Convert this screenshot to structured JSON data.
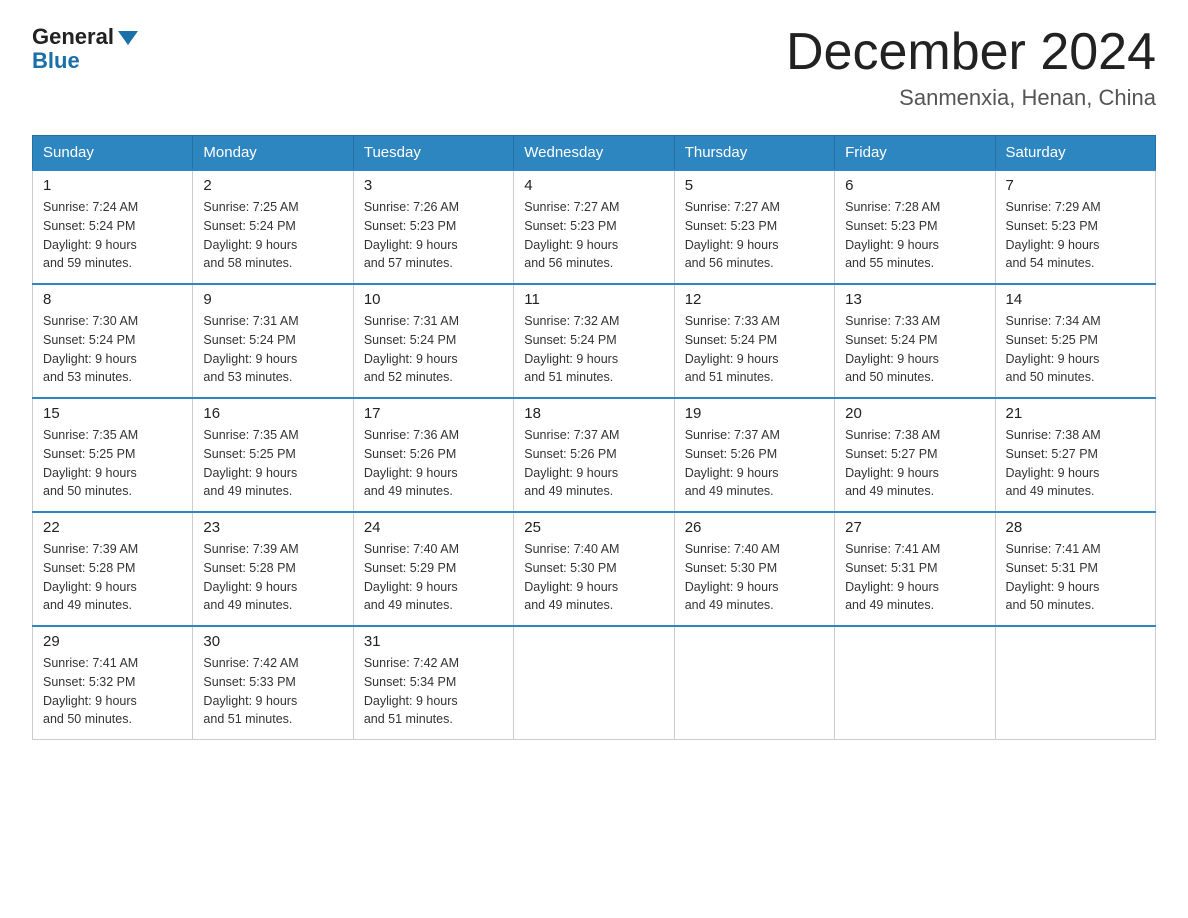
{
  "logo": {
    "general": "General",
    "blue": "Blue"
  },
  "title": "December 2024",
  "location": "Sanmenxia, Henan, China",
  "days_of_week": [
    "Sunday",
    "Monday",
    "Tuesday",
    "Wednesday",
    "Thursday",
    "Friday",
    "Saturday"
  ],
  "weeks": [
    [
      {
        "day": "1",
        "sunrise": "7:24 AM",
        "sunset": "5:24 PM",
        "daylight": "9 hours and 59 minutes."
      },
      {
        "day": "2",
        "sunrise": "7:25 AM",
        "sunset": "5:24 PM",
        "daylight": "9 hours and 58 minutes."
      },
      {
        "day": "3",
        "sunrise": "7:26 AM",
        "sunset": "5:23 PM",
        "daylight": "9 hours and 57 minutes."
      },
      {
        "day": "4",
        "sunrise": "7:27 AM",
        "sunset": "5:23 PM",
        "daylight": "9 hours and 56 minutes."
      },
      {
        "day": "5",
        "sunrise": "7:27 AM",
        "sunset": "5:23 PM",
        "daylight": "9 hours and 56 minutes."
      },
      {
        "day": "6",
        "sunrise": "7:28 AM",
        "sunset": "5:23 PM",
        "daylight": "9 hours and 55 minutes."
      },
      {
        "day": "7",
        "sunrise": "7:29 AM",
        "sunset": "5:23 PM",
        "daylight": "9 hours and 54 minutes."
      }
    ],
    [
      {
        "day": "8",
        "sunrise": "7:30 AM",
        "sunset": "5:24 PM",
        "daylight": "9 hours and 53 minutes."
      },
      {
        "day": "9",
        "sunrise": "7:31 AM",
        "sunset": "5:24 PM",
        "daylight": "9 hours and 53 minutes."
      },
      {
        "day": "10",
        "sunrise": "7:31 AM",
        "sunset": "5:24 PM",
        "daylight": "9 hours and 52 minutes."
      },
      {
        "day": "11",
        "sunrise": "7:32 AM",
        "sunset": "5:24 PM",
        "daylight": "9 hours and 51 minutes."
      },
      {
        "day": "12",
        "sunrise": "7:33 AM",
        "sunset": "5:24 PM",
        "daylight": "9 hours and 51 minutes."
      },
      {
        "day": "13",
        "sunrise": "7:33 AM",
        "sunset": "5:24 PM",
        "daylight": "9 hours and 50 minutes."
      },
      {
        "day": "14",
        "sunrise": "7:34 AM",
        "sunset": "5:25 PM",
        "daylight": "9 hours and 50 minutes."
      }
    ],
    [
      {
        "day": "15",
        "sunrise": "7:35 AM",
        "sunset": "5:25 PM",
        "daylight": "9 hours and 50 minutes."
      },
      {
        "day": "16",
        "sunrise": "7:35 AM",
        "sunset": "5:25 PM",
        "daylight": "9 hours and 49 minutes."
      },
      {
        "day": "17",
        "sunrise": "7:36 AM",
        "sunset": "5:26 PM",
        "daylight": "9 hours and 49 minutes."
      },
      {
        "day": "18",
        "sunrise": "7:37 AM",
        "sunset": "5:26 PM",
        "daylight": "9 hours and 49 minutes."
      },
      {
        "day": "19",
        "sunrise": "7:37 AM",
        "sunset": "5:26 PM",
        "daylight": "9 hours and 49 minutes."
      },
      {
        "day": "20",
        "sunrise": "7:38 AM",
        "sunset": "5:27 PM",
        "daylight": "9 hours and 49 minutes."
      },
      {
        "day": "21",
        "sunrise": "7:38 AM",
        "sunset": "5:27 PM",
        "daylight": "9 hours and 49 minutes."
      }
    ],
    [
      {
        "day": "22",
        "sunrise": "7:39 AM",
        "sunset": "5:28 PM",
        "daylight": "9 hours and 49 minutes."
      },
      {
        "day": "23",
        "sunrise": "7:39 AM",
        "sunset": "5:28 PM",
        "daylight": "9 hours and 49 minutes."
      },
      {
        "day": "24",
        "sunrise": "7:40 AM",
        "sunset": "5:29 PM",
        "daylight": "9 hours and 49 minutes."
      },
      {
        "day": "25",
        "sunrise": "7:40 AM",
        "sunset": "5:30 PM",
        "daylight": "9 hours and 49 minutes."
      },
      {
        "day": "26",
        "sunrise": "7:40 AM",
        "sunset": "5:30 PM",
        "daylight": "9 hours and 49 minutes."
      },
      {
        "day": "27",
        "sunrise": "7:41 AM",
        "sunset": "5:31 PM",
        "daylight": "9 hours and 49 minutes."
      },
      {
        "day": "28",
        "sunrise": "7:41 AM",
        "sunset": "5:31 PM",
        "daylight": "9 hours and 50 minutes."
      }
    ],
    [
      {
        "day": "29",
        "sunrise": "7:41 AM",
        "sunset": "5:32 PM",
        "daylight": "9 hours and 50 minutes."
      },
      {
        "day": "30",
        "sunrise": "7:42 AM",
        "sunset": "5:33 PM",
        "daylight": "9 hours and 51 minutes."
      },
      {
        "day": "31",
        "sunrise": "7:42 AM",
        "sunset": "5:34 PM",
        "daylight": "9 hours and 51 minutes."
      },
      null,
      null,
      null,
      null
    ]
  ],
  "labels": {
    "sunrise": "Sunrise:",
    "sunset": "Sunset:",
    "daylight": "Daylight:"
  }
}
